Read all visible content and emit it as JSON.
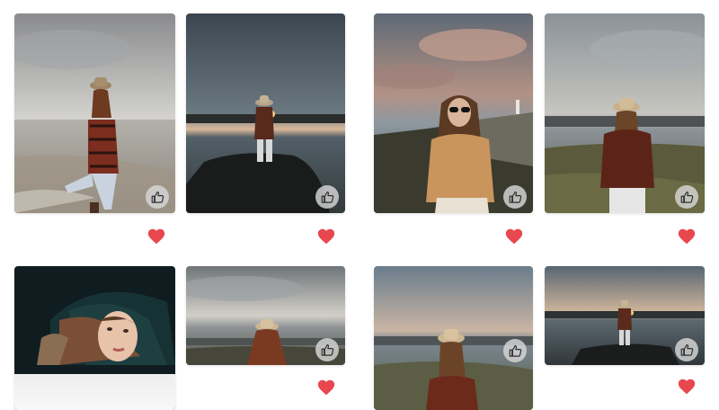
{
  "gallery": {
    "photos": [
      {
        "id": "p1",
        "scene": "beach-shore-woman-standing",
        "like_icon": "thumbs-up-icon",
        "favorite_icon": "heart-icon",
        "favorite_color": "#e8474f"
      },
      {
        "id": "p2",
        "scene": "rock-pier-sunset-back-view",
        "like_icon": "thumbs-up-icon",
        "favorite_icon": "heart-icon",
        "favorite_color": "#e8474f"
      },
      {
        "id": "p3",
        "scene": "coast-cliffs-sunglasses-portrait",
        "like_icon": "thumbs-up-icon",
        "favorite_icon": "heart-icon",
        "favorite_color": "#e8474f"
      },
      {
        "id": "p4",
        "scene": "grassy-coast-back-view",
        "like_icon": "thumbs-up-icon",
        "favorite_icon": "heart-icon",
        "favorite_color": "#e8474f"
      },
      {
        "id": "p5",
        "scene": "dark-blanket-lying-portrait",
        "like_icon": null,
        "favorite_icon": null,
        "favorite_color": null
      },
      {
        "id": "p6",
        "scene": "cloudy-coast-back-view",
        "like_icon": "thumbs-up-icon",
        "favorite_icon": "heart-icon",
        "favorite_color": "#e8474f"
      },
      {
        "id": "p7",
        "scene": "sunset-sea-back-view",
        "like_icon": "thumbs-up-icon",
        "favorite_icon": null,
        "favorite_color": null
      },
      {
        "id": "p8",
        "scene": "rock-pier-sunset-back-view-small",
        "like_icon": "thumbs-up-icon",
        "favorite_icon": "heart-icon",
        "favorite_color": "#e8474f"
      }
    ]
  },
  "colors": {
    "favorite_heart": "#e8474f",
    "like_button_bg": "#d7d7d7",
    "background": "#ffffff"
  }
}
